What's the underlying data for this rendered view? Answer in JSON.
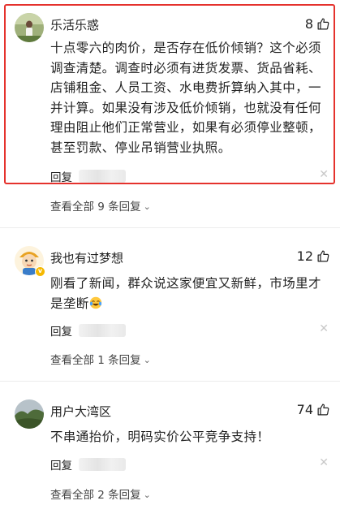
{
  "comments": [
    {
      "username": "乐活乐惑",
      "likes": "8",
      "text": "十点零六的肉价，是否存在低价倾销？这个必须调查清楚。调查时必须有进货发票、货品省耗、店铺租金、人员工资、水电费折算纳入其中，一并计算。如果没有涉及低价倾销，也就没有任何理由阻止他们正常营业，如果有必须停业整顿，甚至罚款、停业吊销营业执照。",
      "reply_label": "回复",
      "view_all": "查看全部 9 条回复",
      "highlighted": true
    },
    {
      "username": "我也有过梦想",
      "likes": "12",
      "text": "刚看了新闻，群众说这家便宜又新鲜，市场里才是垄断",
      "text_emoji": "crying-laughing-emoji",
      "reply_label": "回复",
      "view_all": "查看全部 1 条回复"
    },
    {
      "username": "用户大湾区",
      "likes": "74",
      "text": "不串通抬价，明码实价公平竞争支持！",
      "reply_label": "回复",
      "view_all": "查看全部 2 条回复"
    }
  ],
  "icons": {
    "like": "thumbs-up-icon",
    "close": "close-icon",
    "chevron": "chevron-down-icon",
    "verified": "verified-badge-icon"
  },
  "colors": {
    "highlight_border": "#e5322d",
    "badge": "#f5b800"
  }
}
